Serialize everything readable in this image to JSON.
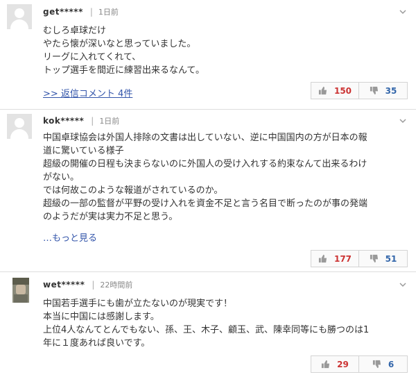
{
  "comments": [
    {
      "user": "get*****",
      "time": "1日前",
      "lines": [
        "むしろ卓球だけ",
        "やたら懐が深いなと思っていました。",
        "リーグに入れてくれて、",
        "トップ選手を間近に練習出来るなんて。"
      ],
      "reply_link": ">> 返信コメント 4件",
      "good": "150",
      "bad": "35"
    },
    {
      "user": "kok*****",
      "time": "1日前",
      "lines": [
        "中国卓球協会は外国人排除の文書は出していない、逆に中国国内の方が日本の報",
        "道に驚いている様子",
        "超級の開催の日程も決まらないのに外国人の受け入れする約束なんて出来るわけ",
        "がない。",
        "では何故このような報道がされているのか。",
        "超級の一部の監督が平野の受け入れを資金不足と言う名目で断ったのが事の発端",
        "のようだが実は実力不足と思う。"
      ],
      "more_link": "…もっと見る",
      "good": "177",
      "bad": "51"
    },
    {
      "user": "wet*****",
      "time": "22時間前",
      "lines": [
        "中国若手選手にも歯が立たないのが現実です！",
        "本当に中国には感謝します。",
        "上位4人なんてとんでもない、孫、王、木子、顧玉、武、陳幸同等にも勝つのは1",
        "年に１度あれば良いです。"
      ],
      "good": "29",
      "bad": "6"
    }
  ],
  "colors": {
    "good": "#cc3333",
    "bad": "#3366aa",
    "link": "#3355aa",
    "divider": "#dddddd"
  },
  "icons": {
    "avatar_default": "default-avatar-icon",
    "avatar_photo": "user-photo-avatar",
    "menu": "chevron-down-icon",
    "good": "thumbs-up-icon",
    "bad": "thumbs-down-icon"
  }
}
